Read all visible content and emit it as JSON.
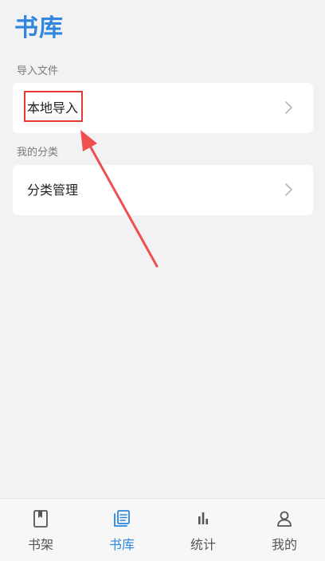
{
  "page": {
    "title": "书库"
  },
  "sections": [
    {
      "label": "导入文件",
      "item_label": "本地导入"
    },
    {
      "label": "我的分类",
      "item_label": "分类管理"
    }
  ],
  "tabbar": {
    "tabs": [
      {
        "label": "书架",
        "icon": "bookshelf-icon",
        "active": false
      },
      {
        "label": "书库",
        "icon": "library-icon",
        "active": true
      },
      {
        "label": "统计",
        "icon": "stats-icon",
        "active": false
      },
      {
        "label": "我的",
        "icon": "profile-icon",
        "active": false
      }
    ]
  },
  "colors": {
    "accent": "#2f86dc",
    "highlight": "#e53935",
    "background": "#f2f2f4",
    "card": "#ffffff"
  }
}
